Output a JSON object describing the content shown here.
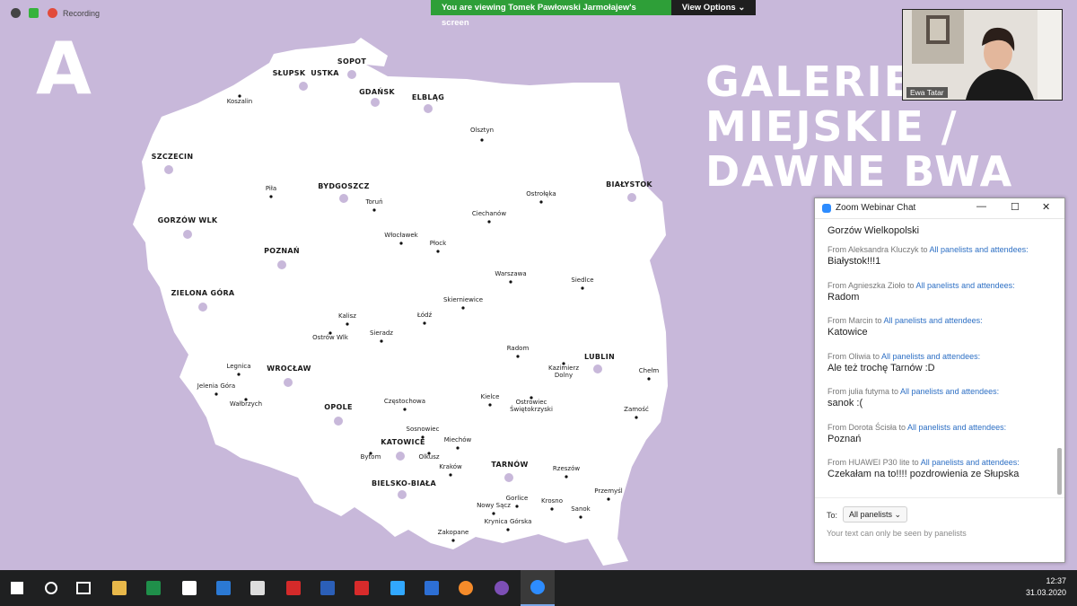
{
  "zoom": {
    "recording_label": "Recording",
    "banner_text": "You are viewing Tomek Pawłowski Jarmołajew's screen",
    "view_options_label": "View Options ⌄"
  },
  "slide": {
    "letter": "A",
    "title_line1": "GALERIE",
    "title_line2": "MIEJSKIE /",
    "title_line3": "DAWNE BWA"
  },
  "map": {
    "big_cities": [
      "SOPOT",
      "SŁUPSK",
      "USTKA",
      "GDAŃSK",
      "ELBLĄG",
      "SZCZECIN",
      "BYDGOSZCZ",
      "BIAŁYSTOK",
      "GORZÓW WLK",
      "POZNAŃ",
      "ZIELONA GÓRA",
      "WROCŁAW",
      "LUBLIN",
      "OPOLE",
      "KATOWICE",
      "TARNÓW",
      "BIELSKO-BIAŁA"
    ],
    "small_cities": [
      "Koszalin",
      "Olsztyn",
      "Piła",
      "Toruń",
      "Ostrołęka",
      "Ciechanów",
      "Włocławek",
      "Płock",
      "Warszawa",
      "Siedlce",
      "Skierniewice",
      "Kalisz",
      "Łódź",
      "Ostrów Wlk",
      "Sieradz",
      "Radom",
      "Legnica",
      "Kazimierz Dolny",
      "Chełm",
      "Jelenia Góra",
      "Wałbrzych",
      "Częstochowa",
      "Kielce",
      "Ostrowiec Świętokrzyski",
      "Zamość",
      "Sosnowiec",
      "Miechów",
      "Bytom",
      "Olkusz",
      "Kraków",
      "Rzeszów",
      "Gorlice",
      "Przemyśl",
      "Nowy Sącz",
      "Krosno",
      "Sanok",
      "Krynica Górska",
      "Zakopane"
    ]
  },
  "video": {
    "name": "Ewa Tatar"
  },
  "chat": {
    "title": "Zoom Webinar Chat",
    "top_partial": "Gorzów Wielkopolski",
    "to_all": "All panelists and attendees:",
    "messages": [
      {
        "sender": "From Aleksandra Kluczyk to",
        "text": "Białystok!!!1"
      },
      {
        "sender": "From Agnieszka Zioło to",
        "text": "Radom"
      },
      {
        "sender": "From Marcin to",
        "text": "Katowice"
      },
      {
        "sender": "From Oliwia  to",
        "text": "Ale też trochę Tarnów :D"
      },
      {
        "sender": "From julia futyma to",
        "text": "sanok :("
      },
      {
        "sender": "From Dorota Ścisła to",
        "text": "Poznań"
      },
      {
        "sender": "From HUAWEI P30 lite to",
        "text": "Czekałam na to!!!! pozdrowienia ze Słupska"
      }
    ],
    "to_label": "To:",
    "to_value": "All panelists ⌄",
    "hint": "Your text can only be seen by panelists"
  },
  "taskbar": {
    "time": "12:37",
    "date": "31.03.2020",
    "apps": [
      "start-icon",
      "search-icon",
      "task-view-icon",
      "file-explorer-icon",
      "excel-icon",
      "store-icon",
      "mail-icon",
      "calculator-icon",
      "adobe-acrobat-icon",
      "word-icon",
      "app-icon",
      "photoshop-icon",
      "arch-app-icon",
      "firefox-icon",
      "viber-icon",
      "zoom-icon"
    ]
  },
  "colors": {
    "background": "#c8b8da",
    "map": "#ffffff",
    "marker": "#c8b8da",
    "banner_green": "#2e9f38",
    "link_blue": "#2d6fc4"
  }
}
